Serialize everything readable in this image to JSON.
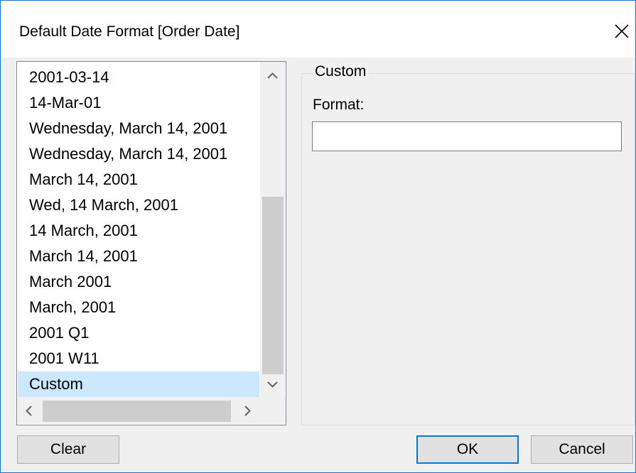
{
  "dialog": {
    "title": "Default Date Format [Order Date]",
    "close_icon": "close-icon"
  },
  "format_list": {
    "items": [
      "2001-03-14",
      "14-Mar-01",
      "Wednesday, March 14, 2001",
      "Wednesday, March 14, 2001",
      "March 14, 2001",
      "Wed, 14 March, 2001",
      "14 March, 2001",
      "March 14, 2001",
      "March 2001",
      "March, 2001",
      "2001 Q1",
      "2001 W11",
      "Custom"
    ],
    "selected": "Custom",
    "scroll_icons": [
      "scroll-up-icon",
      "scroll-down-icon",
      "scroll-left-icon",
      "scroll-right-icon"
    ]
  },
  "custom_group": {
    "title": "Custom",
    "format_label": "Format:",
    "format_value": ""
  },
  "buttons": {
    "clear": "Clear",
    "ok": "OK",
    "cancel": "Cancel"
  },
  "colors": {
    "selection": "#cce8ff",
    "window_border": "#1a73c8",
    "default_button_border": "#0078d7"
  }
}
